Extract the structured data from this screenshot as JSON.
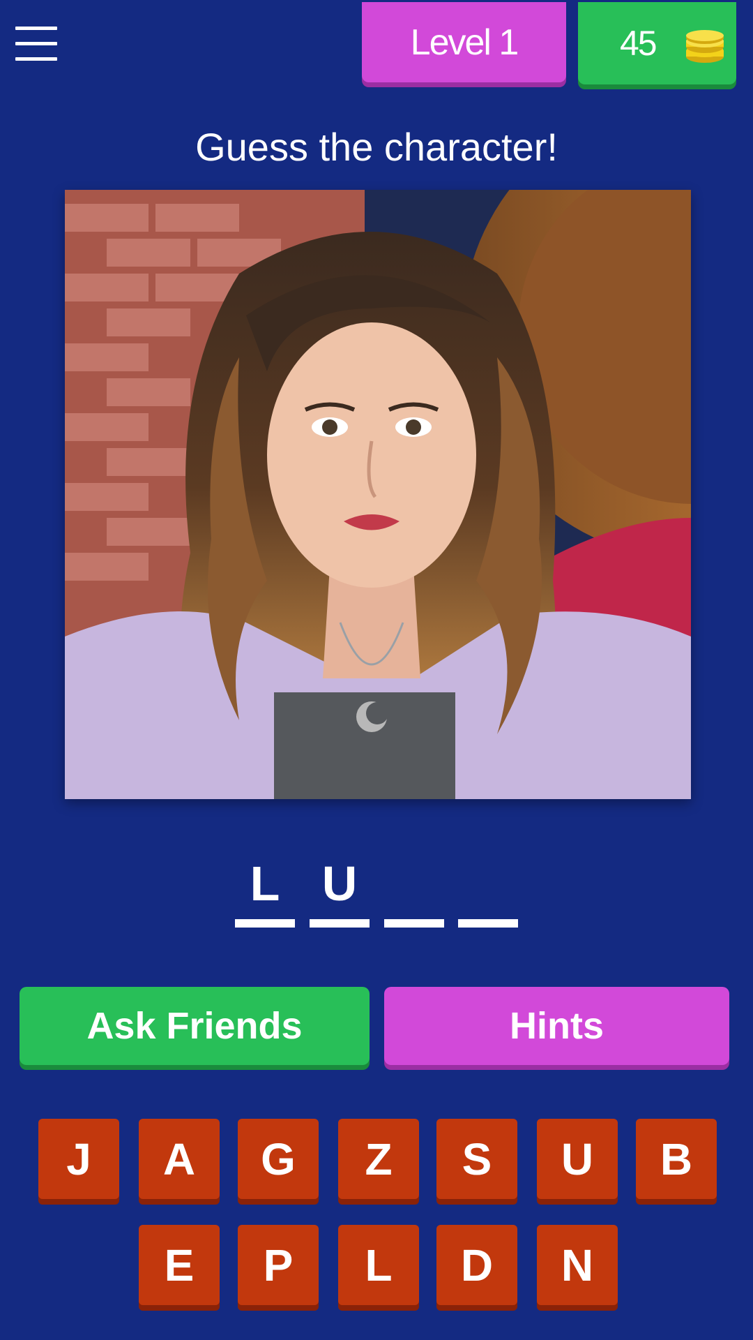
{
  "header": {
    "menu_icon": "hamburger-menu-icon",
    "level_label": "Level 1",
    "coins": "45",
    "coins_icon": "coin-stack-icon"
  },
  "title": "Guess the character!",
  "picture": {
    "icon": "character-photo"
  },
  "answer": {
    "slots": [
      "L",
      "U",
      "",
      ""
    ]
  },
  "actions": {
    "ask_friends_label": "Ask Friends",
    "hints_label": "Hints"
  },
  "keyboard": {
    "row1": [
      "J",
      "A",
      "G",
      "Z",
      "S",
      "U",
      "B"
    ],
    "row2": [
      "E",
      "P",
      "L",
      "D",
      "N"
    ]
  },
  "colors": {
    "background": "#142a82",
    "purple": "#d249d9",
    "green": "#28bf58",
    "key": "#c2380d",
    "coin": "#f3d21a"
  }
}
